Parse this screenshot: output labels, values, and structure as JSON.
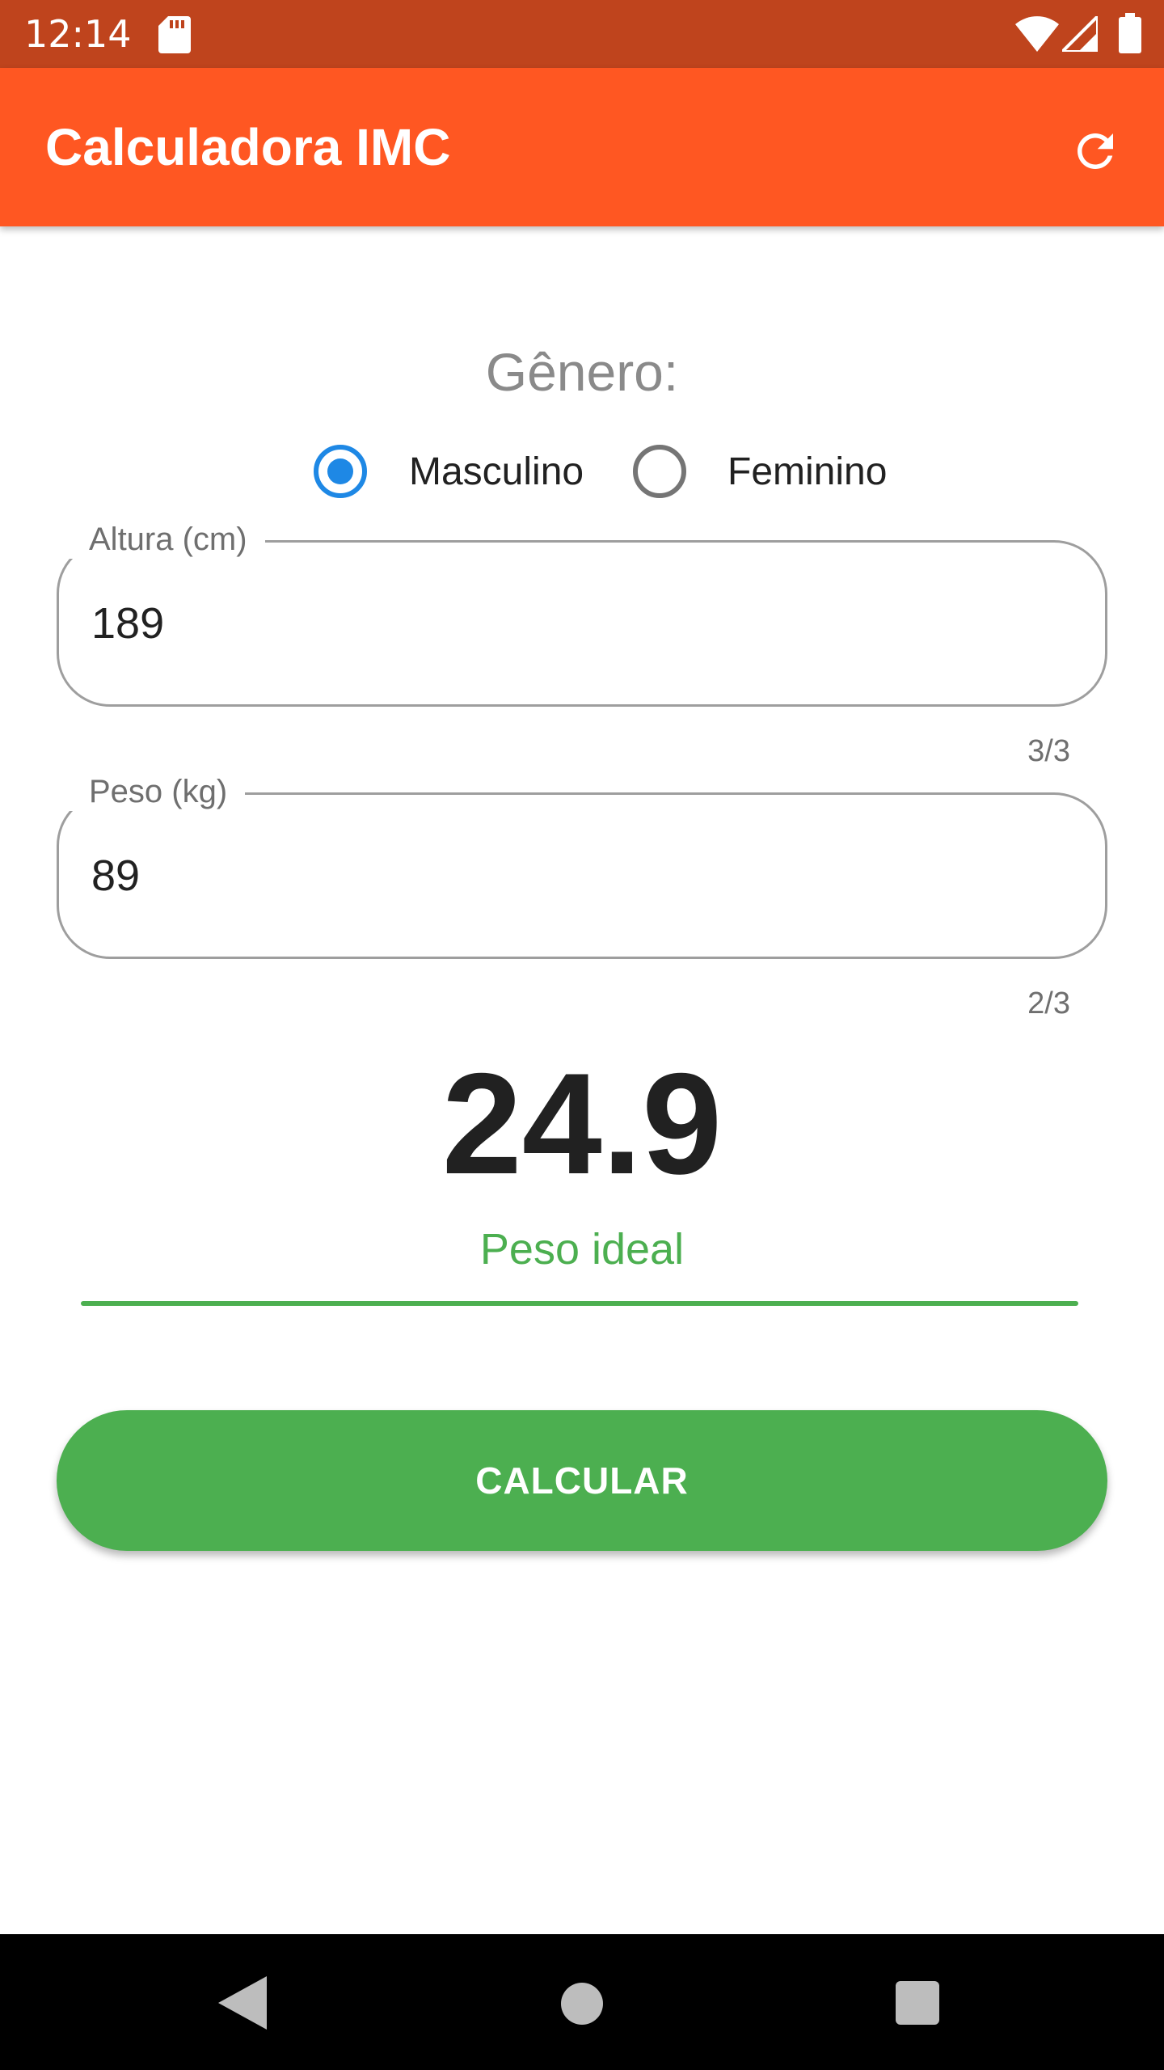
{
  "status_bar": {
    "time": "12:14",
    "icons": [
      "sd-card-icon",
      "wifi-icon",
      "signal-icon",
      "battery-icon"
    ]
  },
  "app_bar": {
    "title": "Calculadora IMC",
    "action_icon": "refresh-icon"
  },
  "gender": {
    "label": "Gênero:",
    "options": [
      {
        "label": "Masculino",
        "selected": true
      },
      {
        "label": "Feminino",
        "selected": false
      }
    ]
  },
  "height_field": {
    "label": "Altura (cm)",
    "value": "189",
    "counter": "3/3"
  },
  "weight_field": {
    "label": "Peso (kg)",
    "value": "89",
    "counter": "2/3"
  },
  "result": {
    "bmi": "24.9",
    "status": "Peso ideal"
  },
  "calculate_button": {
    "label": "CALCULAR"
  },
  "colors": {
    "status_bar": "#BF441D",
    "app_bar": "#FF5722",
    "radio_selected": "#1E88E5",
    "success": "#4CAF50"
  },
  "nav_bar": {
    "icons": [
      "back-icon",
      "home-icon",
      "recents-icon"
    ]
  }
}
